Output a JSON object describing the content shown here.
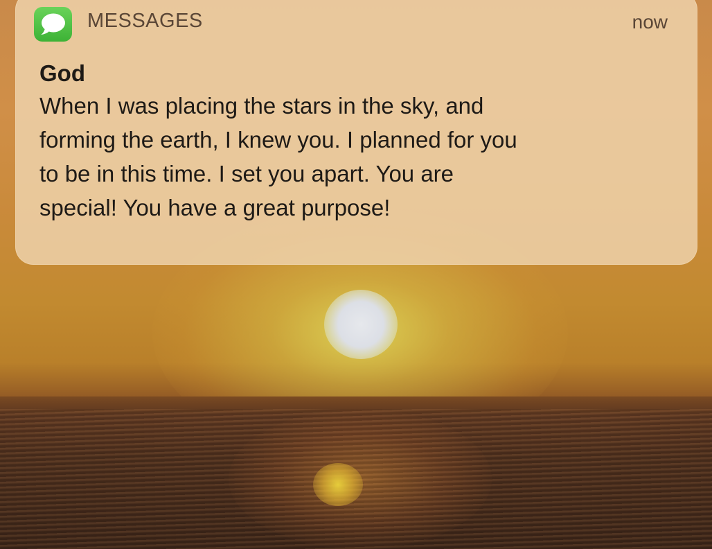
{
  "notification": {
    "app_name": "MESSAGES",
    "app_icon": "messages-bubble-icon",
    "timestamp": "now",
    "sender": "God",
    "message": "When I was placing the stars in the sky, and\nforming the earth, I knew you. I planned for you\nto be in this time. I set you apart.  You are\nspecial! You have a great purpose!"
  },
  "colors": {
    "icon_green": "#4cc143",
    "banner_bg": "#eed2aa",
    "text_primary": "#1e1a16",
    "text_secondary": "#5a4636"
  },
  "wallpaper": {
    "scene": "sunset-over-ocean"
  }
}
